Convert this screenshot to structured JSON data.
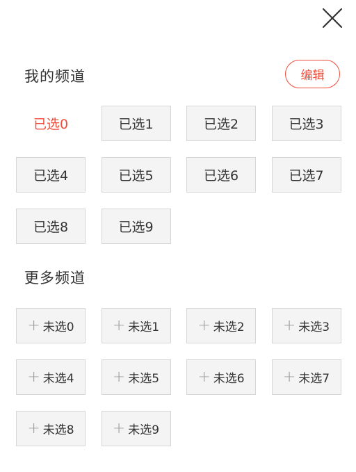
{
  "header": {
    "close_icon": "close-icon"
  },
  "my_channels": {
    "title": "我的频道",
    "edit_label": "编辑",
    "items": [
      {
        "label": "已选0",
        "active": true
      },
      {
        "label": "已选1",
        "active": false
      },
      {
        "label": "已选2",
        "active": false
      },
      {
        "label": "已选3",
        "active": false
      },
      {
        "label": "已选4",
        "active": false
      },
      {
        "label": "已选5",
        "active": false
      },
      {
        "label": "已选6",
        "active": false
      },
      {
        "label": "已选7",
        "active": false
      },
      {
        "label": "已选8",
        "active": false
      },
      {
        "label": "已选9",
        "active": false
      }
    ]
  },
  "more_channels": {
    "title": "更多频道",
    "plus_symbol": "+",
    "items": [
      {
        "label": "未选0"
      },
      {
        "label": "未选1"
      },
      {
        "label": "未选2"
      },
      {
        "label": "未选3"
      },
      {
        "label": "未选4"
      },
      {
        "label": "未选5"
      },
      {
        "label": "未选6"
      },
      {
        "label": "未选7"
      },
      {
        "label": "未选8"
      },
      {
        "label": "未选9"
      }
    ]
  },
  "colors": {
    "accent": "#f04c3b",
    "chip_bg": "#f4f4f4",
    "chip_border": "#d6d6d6",
    "text": "#333333",
    "plus": "#9a9a9a"
  }
}
